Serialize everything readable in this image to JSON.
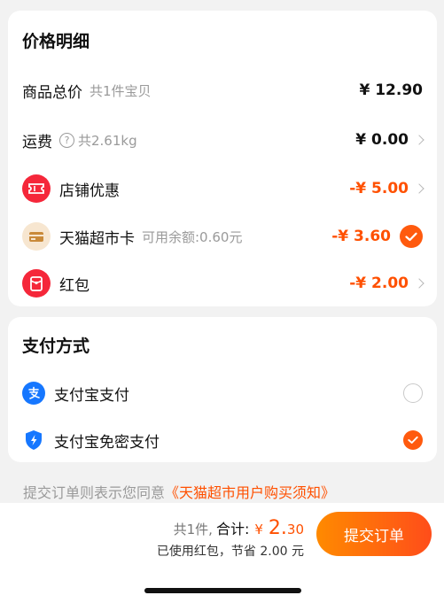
{
  "price_details": {
    "title": "价格明细",
    "goods_total": {
      "label": "商品总价",
      "sub": "共1件宝贝",
      "amount": "¥ 12.90"
    },
    "shipping": {
      "label": "运费",
      "icon": "question-icon",
      "sub": "共2.61kg",
      "amount": "¥ 0.00"
    },
    "store_discount": {
      "label": "店铺优惠",
      "icon": "coupon-icon",
      "amount": "-¥ 5.00"
    },
    "market_card": {
      "label": "天猫超市卡",
      "icon": "card-icon",
      "sub": "可用余额:0.60元",
      "amount": "-¥ 3.60",
      "checked": true
    },
    "red_packet": {
      "label": "红包",
      "icon": "red-packet-icon",
      "amount": "-¥ 2.00"
    }
  },
  "payment": {
    "title": "支付方式",
    "options": [
      {
        "label": "支付宝支付",
        "icon": "alipay-icon",
        "selected": false
      },
      {
        "label": "支付宝免密支付",
        "icon": "alipay-shield-icon",
        "selected": true
      }
    ]
  },
  "agreement": {
    "prefix": "提交订单则表示您同意",
    "link": "《天猫超市用户购买须知》"
  },
  "footer": {
    "count": "共1件,",
    "total_label": "合计:",
    "currency": "¥",
    "total_int": "2.",
    "total_dec": "30",
    "saved": "已使用红包，节省 2.00 元",
    "submit": "提交订单"
  },
  "colors": {
    "accent": "#ff5000",
    "button_start": "#ff8a00",
    "button_end": "#ff4d1a",
    "red": "#f5273a"
  }
}
